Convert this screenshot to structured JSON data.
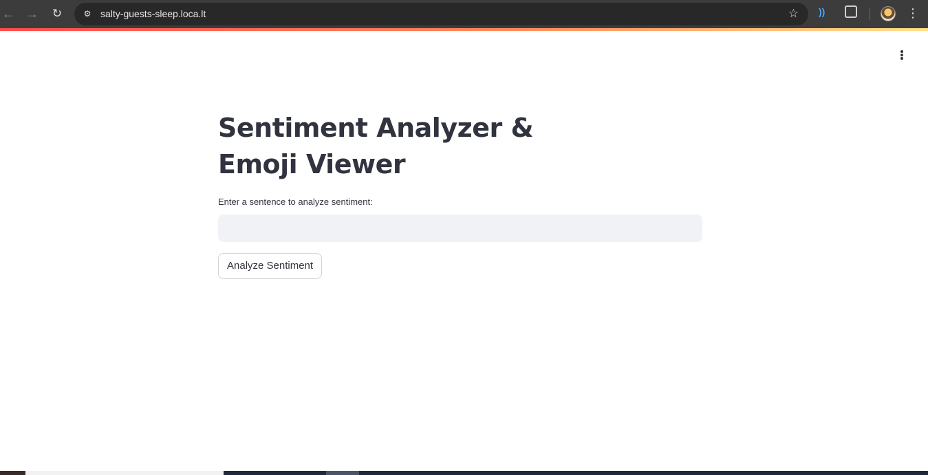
{
  "browser": {
    "back_icon": "←",
    "forward_icon": "→",
    "reload_icon": "↻",
    "site_info_icon": "⚙",
    "url": "salty-guests-sleep.loca.lt",
    "star_icon": "☆",
    "extension_icon": "))",
    "menu_icon": "⋮"
  },
  "app": {
    "title": "Sentiment Analyzer & Emoji Viewer",
    "input_label": "Enter a sentence to analyze sentiment:",
    "input_value": "",
    "input_placeholder": "",
    "button_label": "Analyze Sentiment",
    "accent_color": "#ff4b4b",
    "text_color": "#31333f",
    "input_bg": "#f0f2f6"
  }
}
